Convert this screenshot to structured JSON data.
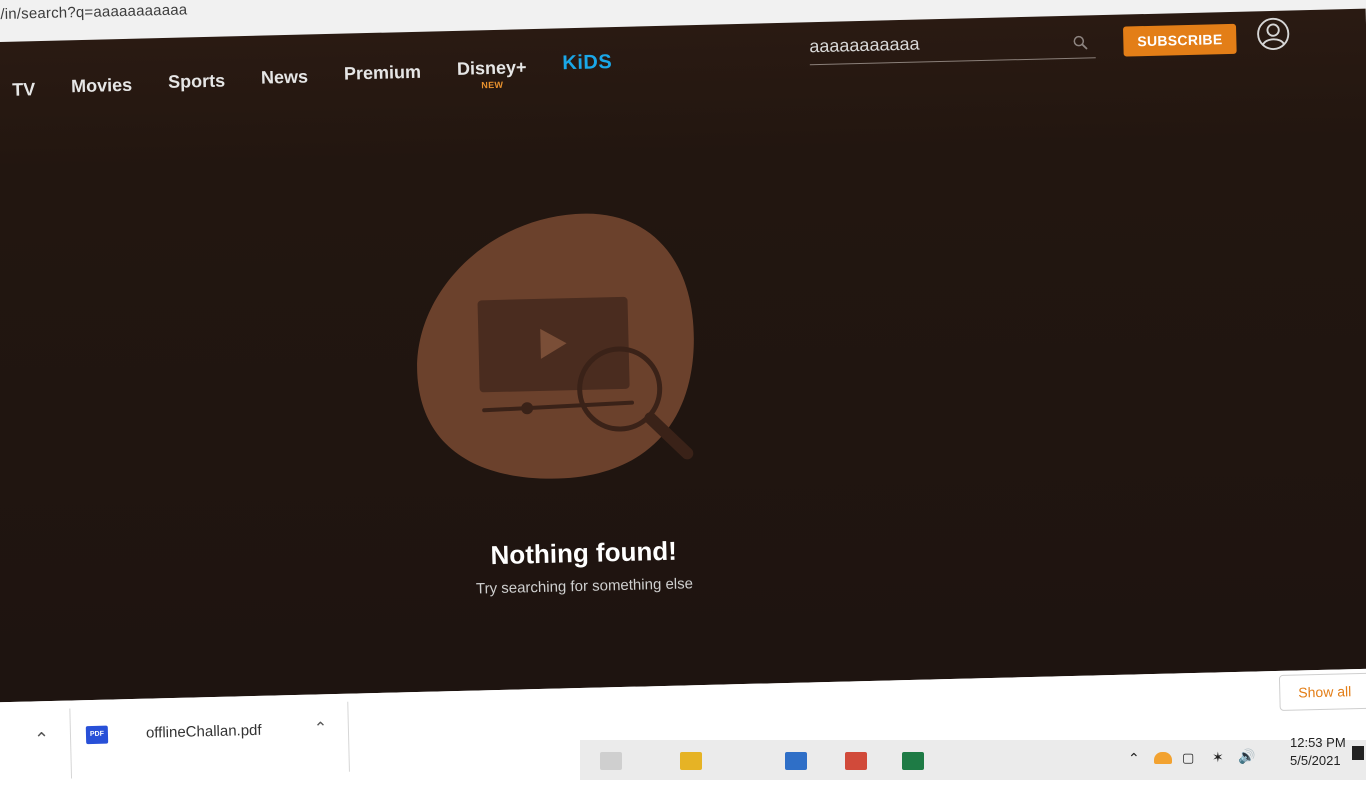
{
  "browser": {
    "url": "/in/search?q=aaaaaaaaaaa"
  },
  "header": {
    "nav": [
      {
        "label": "TV"
      },
      {
        "label": "Movies"
      },
      {
        "label": "Sports"
      },
      {
        "label": "News"
      },
      {
        "label": "Premium"
      },
      {
        "label": "Disney+",
        "badge": "NEW"
      },
      {
        "label": "KiDS"
      }
    ],
    "search": {
      "value": "aaaaaaaaaaa",
      "icon": "search-icon"
    },
    "subscribe_label": "SUBSCRIBE",
    "avatar_icon": "user-icon"
  },
  "empty_state": {
    "illustration": "video-search-illustration",
    "title": "Nothing found!",
    "subtitle": "Try searching for something else"
  },
  "downloads": {
    "file_name": "offlineChallan.pdf",
    "file_type_label": "PDF",
    "show_all_label": "Show all"
  },
  "taskbar": {
    "time": "12:53 PM",
    "date": "5/5/2021"
  },
  "colors": {
    "accent": "#e37e17",
    "kids": "#1aa7e8",
    "page_bg": "#1e1410"
  }
}
